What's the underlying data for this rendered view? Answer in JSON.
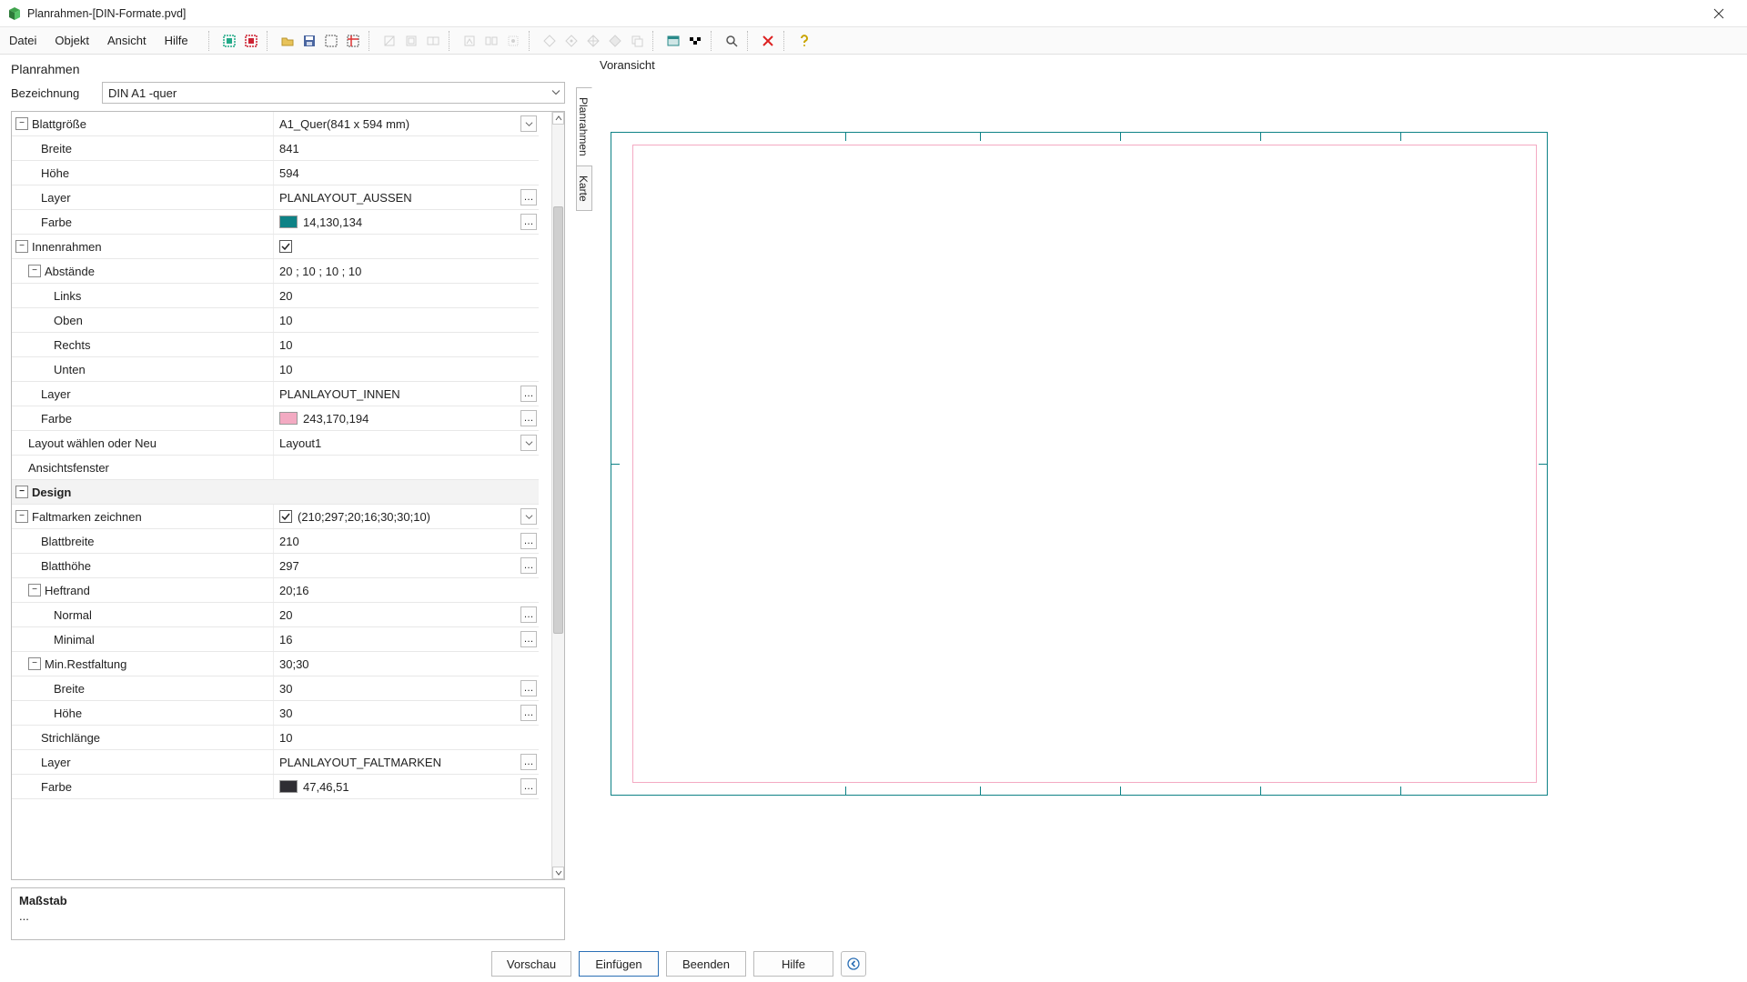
{
  "window": {
    "title": "Planrahmen-[DIN-Formate.pvd]"
  },
  "menu": {
    "datei": "Datei",
    "objekt": "Objekt",
    "ansicht": "Ansicht",
    "hilfe": "Hilfe"
  },
  "panel": {
    "title": "Planrahmen",
    "bez_label": "Bezeichnung",
    "bez_value": "DIN A1 -quer"
  },
  "vtabs": {
    "planrahmen": "Planrahmen",
    "karte": "Karte"
  },
  "grid": {
    "blattgroesse": {
      "label": "Blattgröße",
      "value": "A1_Quer(841 x 594 mm)"
    },
    "breite": {
      "label": "Breite",
      "value": "841"
    },
    "hoehe": {
      "label": "Höhe",
      "value": "594"
    },
    "layer_aussen": {
      "label": "Layer",
      "value": "PLANLAYOUT_AUSSEN"
    },
    "farbe_aussen": {
      "label": "Farbe",
      "value": "14,130,134",
      "hex": "#0e8286"
    },
    "innenrahmen": {
      "label": "Innenrahmen",
      "checked": true
    },
    "abstaende": {
      "label": "Abstände",
      "value": "20 ; 10 ; 10 ; 10"
    },
    "links": {
      "label": "Links",
      "value": "20"
    },
    "oben": {
      "label": "Oben",
      "value": "10"
    },
    "rechts": {
      "label": "Rechts",
      "value": "10"
    },
    "unten": {
      "label": "Unten",
      "value": "10"
    },
    "layer_innen": {
      "label": "Layer",
      "value": "PLANLAYOUT_INNEN"
    },
    "farbe_innen": {
      "label": "Farbe",
      "value": "243,170,194",
      "hex": "#f3aac2"
    },
    "layout_waehlen": {
      "label": "Layout wählen oder Neu",
      "value": "Layout1"
    },
    "ansichtsfenster": {
      "label": "Ansichtsfenster",
      "value": ""
    },
    "design": {
      "label": "Design"
    },
    "faltmarken": {
      "label": "Faltmarken zeichnen",
      "checked": true,
      "value": "(210;297;20;16;30;30;10)"
    },
    "blattbreite": {
      "label": "Blattbreite",
      "value": "210"
    },
    "blatthoehe": {
      "label": "Blatthöhe",
      "value": "297"
    },
    "heftrand": {
      "label": "Heftrand",
      "value": "20;16"
    },
    "normal": {
      "label": "Normal",
      "value": "20"
    },
    "minimal": {
      "label": "Minimal",
      "value": "16"
    },
    "minrest": {
      "label": "Min.Restfaltung",
      "value": "30;30"
    },
    "mr_breite": {
      "label": "Breite",
      "value": "30"
    },
    "mr_hoehe": {
      "label": "Höhe",
      "value": "30"
    },
    "strichlaenge": {
      "label": "Strichlänge",
      "value": "10"
    },
    "layer_falt": {
      "label": "Layer",
      "value": "PLANLAYOUT_FALTMARKEN"
    },
    "farbe_falt": {
      "label": "Farbe",
      "value": "47,46,51",
      "hex": "#2f2e33"
    }
  },
  "desc": {
    "title": "Maßstab",
    "body": "..."
  },
  "preview": {
    "title": "Voransicht"
  },
  "footer": {
    "vorschau": "Vorschau",
    "einfuegen": "Einfügen",
    "beenden": "Beenden",
    "hilfe": "Hilfe"
  }
}
